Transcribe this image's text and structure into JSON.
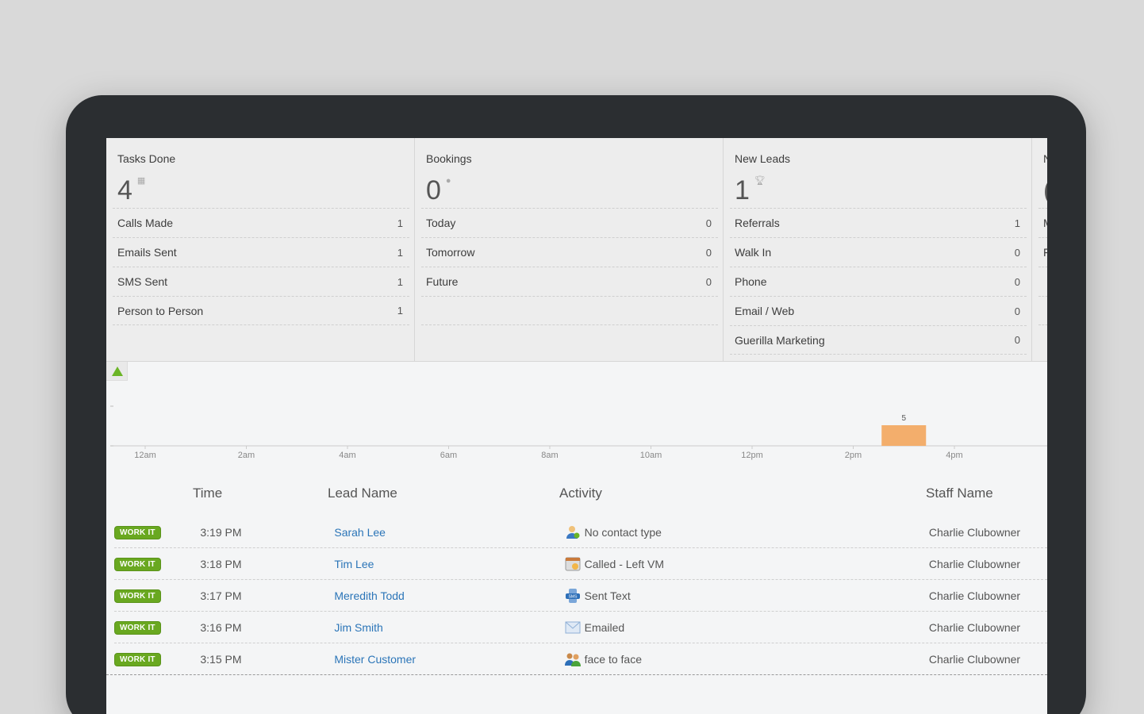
{
  "cards": [
    {
      "title": "Tasks Done",
      "big": "4",
      "icon": "calendar-icon",
      "rows": [
        {
          "label": "Calls Made",
          "value": "1"
        },
        {
          "label": "Emails Sent",
          "value": "1"
        },
        {
          "label": "SMS Sent",
          "value": "1"
        },
        {
          "label": "Person to Person",
          "value": "1"
        }
      ]
    },
    {
      "title": "Bookings",
      "big": "0",
      "icon": "pin-icon",
      "rows": [
        {
          "label": "Today",
          "value": "0"
        },
        {
          "label": "Tomorrow",
          "value": "0"
        },
        {
          "label": "Future",
          "value": "0"
        }
      ]
    },
    {
      "title": "New Leads",
      "big": "1",
      "icon": "trophy-icon",
      "rows": [
        {
          "label": "Referrals",
          "value": "1"
        },
        {
          "label": "Walk In",
          "value": "0"
        },
        {
          "label": "Phone",
          "value": "0"
        },
        {
          "label": "Email / Web",
          "value": "0"
        },
        {
          "label": "Guerilla Marketing",
          "value": "0"
        }
      ]
    }
  ],
  "partial_card": {
    "title": "N",
    "big": "(",
    "rows": [
      "M",
      "F"
    ]
  },
  "chart_data": {
    "type": "bar",
    "categories": [
      "12am",
      "2am",
      "4am",
      "6am",
      "8am",
      "10am",
      "12pm",
      "2pm",
      "4pm"
    ],
    "bars": [
      {
        "x": "3pm",
        "value": 5
      }
    ],
    "bar_color": "#f3ae6c"
  },
  "table": {
    "headers": {
      "time": "Time",
      "lead": "Lead Name",
      "activity": "Activity",
      "staff": "Staff Name"
    },
    "button_label": "WORK IT",
    "rows": [
      {
        "time": "3:19 PM",
        "lead": "Sarah Lee",
        "activity": "No contact type",
        "icon": "person-icon",
        "staff": "Charlie Clubowner"
      },
      {
        "time": "3:18 PM",
        "lead": "Tim Lee",
        "activity": "Called - Left VM",
        "icon": "phone-call-icon",
        "staff": "Charlie Clubowner"
      },
      {
        "time": "3:17 PM",
        "lead": "Meredith Todd",
        "activity": "Sent Text",
        "icon": "sms-icon",
        "staff": "Charlie Clubowner"
      },
      {
        "time": "3:16 PM",
        "lead": "Jim Smith",
        "activity": "Emailed",
        "icon": "email-icon",
        "staff": "Charlie Clubowner"
      },
      {
        "time": "3:15 PM",
        "lead": "Mister Customer",
        "activity": "face to face",
        "icon": "people-icon",
        "staff": "Charlie Clubowner"
      }
    ]
  }
}
